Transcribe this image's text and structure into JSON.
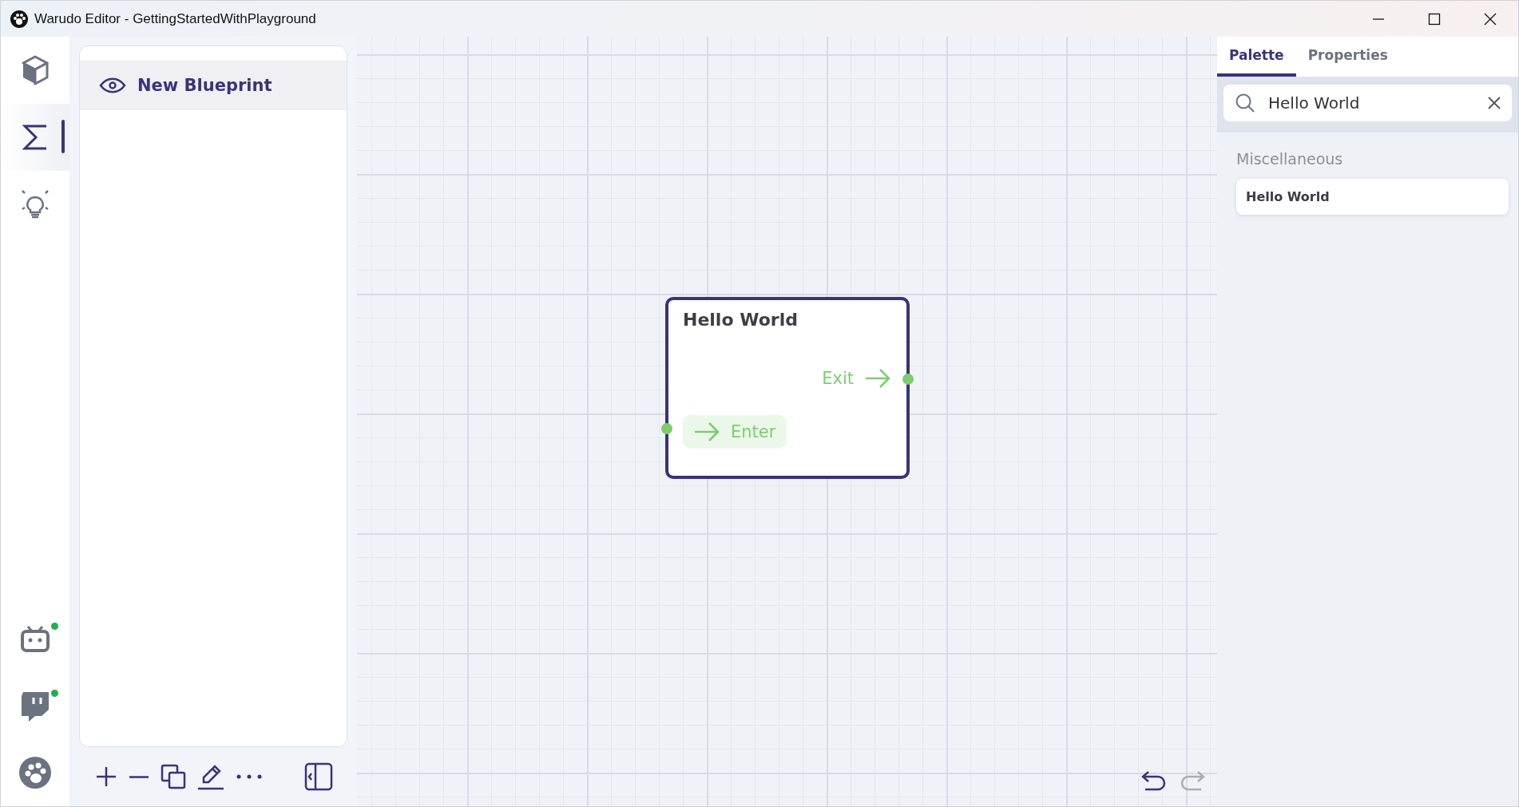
{
  "window": {
    "title": "Warudo Editor - GettingStartedWithPlayground"
  },
  "rail": [
    {
      "kind": "cube",
      "selected": false,
      "connected": false
    },
    {
      "kind": "sigma",
      "selected": true,
      "connected": false
    },
    {
      "kind": "bulb",
      "selected": false,
      "connected": false
    },
    {
      "kind": "tv",
      "selected": false,
      "connected": true
    },
    {
      "kind": "chat",
      "selected": false,
      "connected": true
    },
    {
      "kind": "paw",
      "selected": false,
      "connected": false
    }
  ],
  "blueprints": [
    {
      "name": "New Blueprint",
      "selected": true
    }
  ],
  "canvas": {
    "node": {
      "title": "Hello World",
      "ports": [
        {
          "label": "Exit",
          "kind": "output",
          "active": false
        },
        {
          "label": "Enter",
          "kind": "input",
          "active": true
        }
      ]
    },
    "undo_disabled": false,
    "redo_disabled": true
  },
  "tabs": [
    {
      "label": "Palette",
      "selected": true
    },
    {
      "label": "Properties",
      "selected": false
    }
  ],
  "search": {
    "value": "Hello World"
  },
  "palette": [
    {
      "category": "Miscellaneous",
      "items": [
        "Hello World"
      ]
    }
  ]
}
